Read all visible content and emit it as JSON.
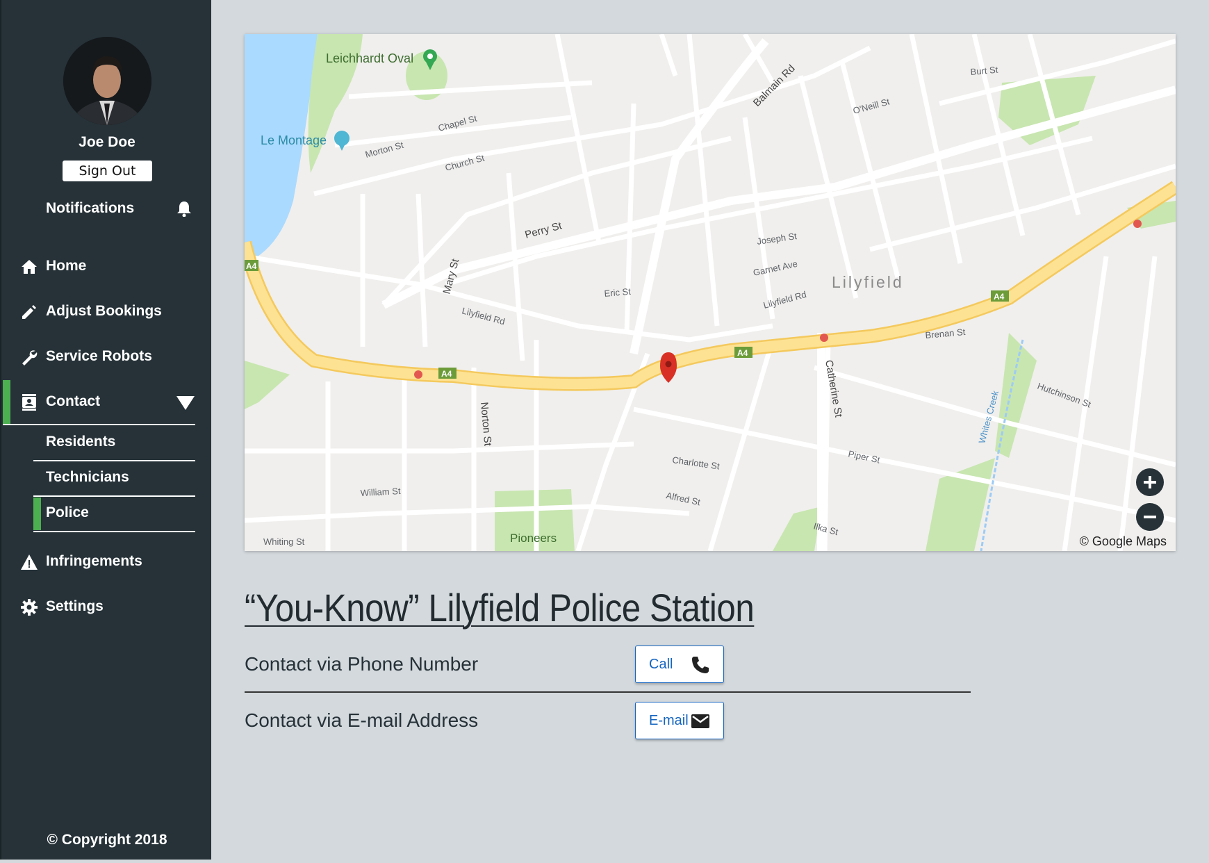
{
  "user": {
    "name": "Joe Doe",
    "sign_out": "Sign Out"
  },
  "notifications": {
    "label": "Notifications"
  },
  "nav": {
    "home": "Home",
    "adjust_bookings": "Adjust Bookings",
    "service_robots": "Service Robots",
    "contact": "Contact",
    "contact_sub": {
      "residents": "Residents",
      "technicians": "Technicians",
      "police": "Police"
    },
    "infringements": "Infringements",
    "settings": "Settings"
  },
  "footer": {
    "copyright": "© Copyright 2018"
  },
  "map": {
    "attribution": "© Google Maps",
    "labels": {
      "oval": "Leichhardt Oval",
      "le_montage": "Le Montage",
      "suburb": "Lilyfield",
      "perry_st": "Perry St",
      "balmain_rd": "Balmain Rd",
      "catherine_st": "Catherine St",
      "norton_st": "Norton St",
      "mary_st": "Mary St",
      "lilyfield_rd": "Lilyfield Rd",
      "lilyfield_rd2": "Lilyfield Rd",
      "brenan_st": "Brenan St",
      "piper_st": "Piper St",
      "joseph_st": "Joseph St",
      "garnet_ave": "Garnet Ave",
      "eric_st": "Eric St",
      "william_st": "William St",
      "whiting_st": "Whiting St",
      "alfred_st": "Alfred St",
      "charlotte_st": "Charlotte St",
      "pioneers": "Pioneers",
      "chapel_st": "Chapel St",
      "church_st": "Church St",
      "morton_st": "Morton St",
      "burt_st": "Burt St",
      "oneill_st": "O'Neill St",
      "hutchinson_st": "Hutchinson St",
      "ilka_st": "Ilka St",
      "whites_creek": "Whites Creek",
      "a4": "A4"
    },
    "colors": {
      "highway": "#fde293",
      "park": "#c8e6b0",
      "water": "#aadaff",
      "road": "#ffffff",
      "marker": "#d93025"
    }
  },
  "station": {
    "title": "“You-Know” Lilyfield Police Station",
    "phone_label": "Contact via Phone Number",
    "email_label": "Contact via E-mail Address",
    "call_button": "Call",
    "email_button": "E-mail"
  },
  "icons": [
    "bell-icon",
    "home-icon",
    "pencil-icon",
    "wrench-icon",
    "contact-icon",
    "warning-icon",
    "gear-icon",
    "phone-icon",
    "mail-icon",
    "plus-icon",
    "minus-icon",
    "map-pin-icon"
  ],
  "theme": {
    "sidebar": "#263238",
    "accent": "#4caf50",
    "background": "#d3d9dd",
    "link": "#1565c0"
  }
}
